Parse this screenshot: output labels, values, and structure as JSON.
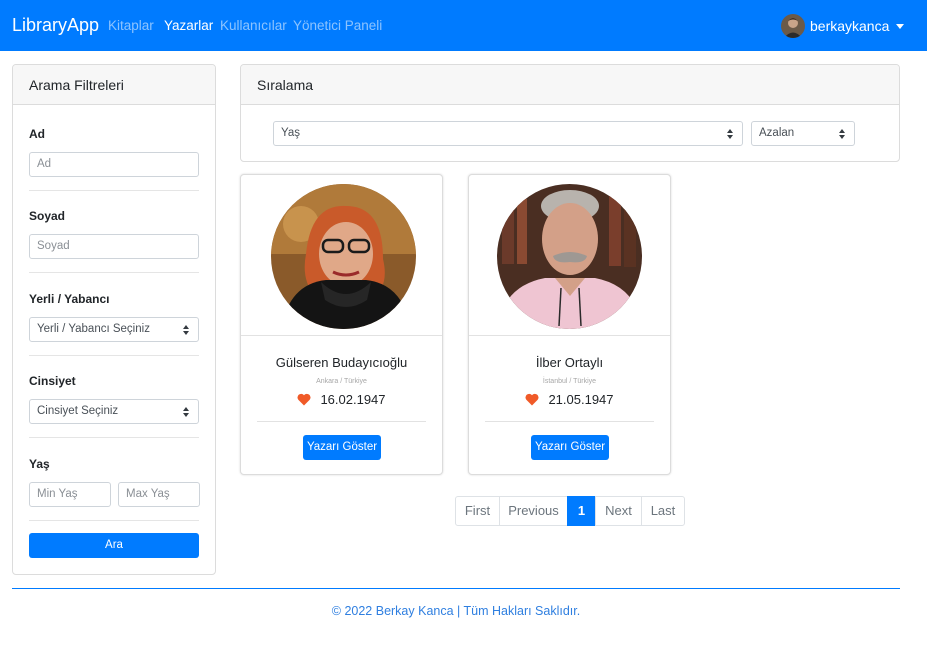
{
  "navbar": {
    "brand": "LibraryApp",
    "links": [
      {
        "label": "Kitaplar",
        "active": false
      },
      {
        "label": "Yazarlar",
        "active": true
      },
      {
        "label": "Kullanıcılar",
        "active": false
      },
      {
        "label": "Yönetici Paneli",
        "active": false
      }
    ],
    "username": "berkaykanca"
  },
  "filters": {
    "title": "Arama Filtreleri",
    "name_label": "Ad",
    "name_placeholder": "Ad",
    "surname_label": "Soyad",
    "surname_placeholder": "Soyad",
    "origin_label": "Yerli / Yabancı",
    "origin_value": "Yerli / Yabancı Seçiniz",
    "gender_label": "Cinsiyet",
    "gender_value": "Cinsiyet Seçiniz",
    "age_label": "Yaş",
    "min_age_placeholder": "Min Yaş",
    "max_age_placeholder": "Max Yaş",
    "search_button": "Ara"
  },
  "sorting": {
    "title": "Sıralama",
    "field_value": "Yaş",
    "order_value": "Azalan"
  },
  "authors": [
    {
      "name": "Gülseren Budayıcıoğlu",
      "place": "Ankara / Türkiye",
      "birth": "16.02.1947",
      "button": "Yazarı Göster"
    },
    {
      "name": "İlber Ortaylı",
      "place": "İstanbul / Türkiye",
      "birth": "21.05.1947",
      "button": "Yazarı Göster"
    }
  ],
  "pagination": {
    "first": "First",
    "previous": "Previous",
    "current": "1",
    "next": "Next",
    "last": "Last"
  },
  "footer": {
    "text": "© 2022 Berkay Kanca | Tüm Hakları Saklıdır."
  },
  "colors": {
    "primary": "#007bff",
    "heart": "#f05a28"
  }
}
